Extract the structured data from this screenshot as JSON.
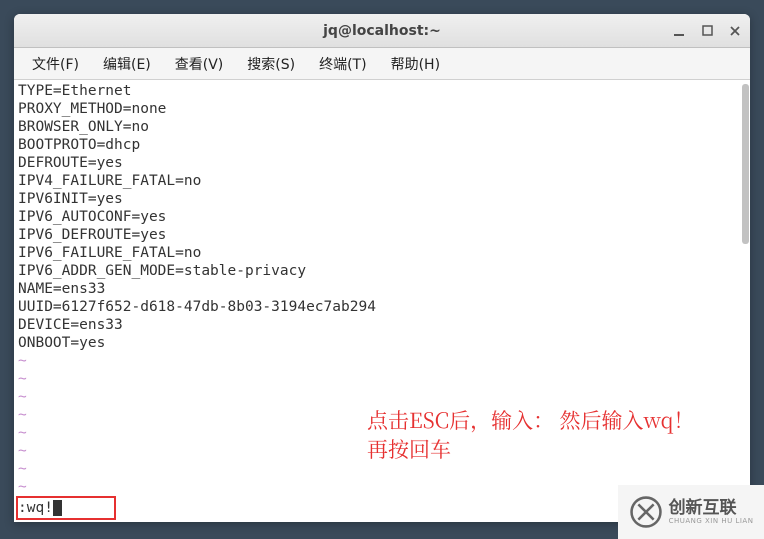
{
  "window": {
    "title": "jq@localhost:~"
  },
  "menu": {
    "file": "文件(F)",
    "edit": "编辑(E)",
    "view": "查看(V)",
    "search": "搜索(S)",
    "terminal": "终端(T)",
    "help": "帮助(H)"
  },
  "terminal_lines": [
    "TYPE=Ethernet",
    "PROXY_METHOD=none",
    "BROWSER_ONLY=no",
    "BOOTPROTO=dhcp",
    "DEFROUTE=yes",
    "IPV4_FAILURE_FATAL=no",
    "IPV6INIT=yes",
    "IPV6_AUTOCONF=yes",
    "IPV6_DEFROUTE=yes",
    "IPV6_FAILURE_FATAL=no",
    "IPV6_ADDR_GEN_MODE=stable-privacy",
    "NAME=ens33",
    "UUID=6127f652-d618-47db-8b03-3194ec7ab294",
    "DEVICE=ens33",
    "ONBOOT=yes"
  ],
  "tilde": "~",
  "command": ":wq!",
  "annotation": {
    "line1": "点击ESC后，输入：  然后输入wq！",
    "line2": "再按回车"
  },
  "watermark": {
    "text": "创新互联",
    "sub": "CHUANG XIN HU LIAN"
  }
}
